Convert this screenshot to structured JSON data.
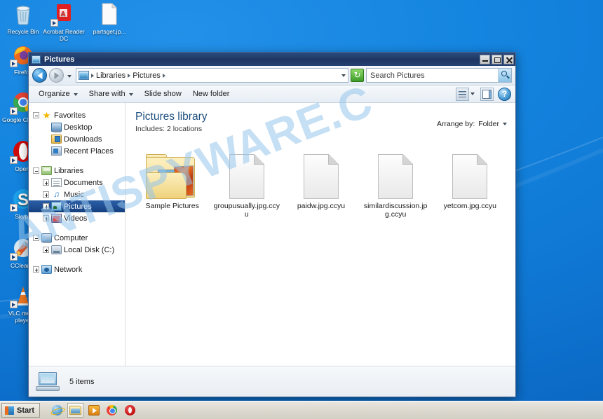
{
  "desktop": {
    "icons": [
      {
        "name": "recycle-bin",
        "label": "Recycle Bin",
        "shortcut": false
      },
      {
        "name": "acrobat-reader",
        "label": "Acrobat Reader DC",
        "shortcut": true
      },
      {
        "name": "partsget-jpg",
        "label": "partsget.jp...",
        "shortcut": false
      },
      {
        "name": "firefox",
        "label": "Firefox",
        "shortcut": true
      },
      {
        "name": "google-chrome",
        "label": "Google Chrome",
        "shortcut": true
      },
      {
        "name": "opera",
        "label": "Opera",
        "shortcut": true
      },
      {
        "name": "skype",
        "label": "Skype",
        "shortcut": true
      },
      {
        "name": "ccleaner",
        "label": "CCleaner",
        "shortcut": true
      },
      {
        "name": "vlc-media-player",
        "label": "VLC media player",
        "shortcut": true
      }
    ]
  },
  "window": {
    "title": "Pictures",
    "controls": {
      "minimize": "Minimize",
      "maximize": "Maximize",
      "close": "Close"
    }
  },
  "address": {
    "back": "Back",
    "forward": "Forward",
    "history": "Recent pages",
    "crumbs": [
      "Libraries",
      "Pictures"
    ],
    "refresh": "Refresh"
  },
  "search": {
    "placeholder": "Search Pictures",
    "value": "Search Pictures"
  },
  "toolbar": {
    "organize": "Organize",
    "share_with": "Share with",
    "slide_show": "Slide show",
    "new_folder": "New folder",
    "change_view": "Change your view",
    "preview_pane": "Show the preview pane",
    "help": "?"
  },
  "library": {
    "title": "Pictures library",
    "includes_label": "Includes:",
    "includes_value": "2 locations",
    "arrange_label": "Arrange by:",
    "arrange_value": "Folder"
  },
  "navpane": {
    "groups": [
      {
        "name": "favorites",
        "header": {
          "label": "Favorites",
          "icon": "star-icon",
          "expander": "minus"
        },
        "items": [
          {
            "label": "Desktop",
            "icon": "monitor-icon",
            "expander": "none",
            "selected": false
          },
          {
            "label": "Downloads",
            "icon": "downloads-folder-icon",
            "expander": "none",
            "selected": false
          },
          {
            "label": "Recent Places",
            "icon": "recent-places-icon",
            "expander": "none",
            "selected": false
          }
        ]
      },
      {
        "name": "libraries",
        "header": {
          "label": "Libraries",
          "icon": "library-icon",
          "expander": "minus"
        },
        "items": [
          {
            "label": "Documents",
            "icon": "document-icon",
            "expander": "plus",
            "selected": false
          },
          {
            "label": "Music",
            "icon": "music-note-icon",
            "expander": "plus",
            "selected": false
          },
          {
            "label": "Pictures",
            "icon": "pictures-icon",
            "expander": "plus",
            "selected": true
          },
          {
            "label": "Videos",
            "icon": "video-icon",
            "expander": "plus",
            "selected": false
          }
        ]
      },
      {
        "name": "computer",
        "header": {
          "label": "Computer",
          "icon": "computer-icon",
          "expander": "minus"
        },
        "items": [
          {
            "label": "Local Disk (C:)",
            "icon": "hard-disk-icon",
            "expander": "plus",
            "selected": false
          }
        ]
      },
      {
        "name": "network",
        "header": {
          "label": "Network",
          "icon": "network-icon",
          "expander": "plus"
        },
        "items": []
      }
    ]
  },
  "files": [
    {
      "name": "Sample Pictures",
      "icon": "pictures-folder-icon",
      "type": "folder"
    },
    {
      "name": "groupusually.jpg.ccyu",
      "icon": "blank-file-icon",
      "type": "file"
    },
    {
      "name": "paidw.jpg.ccyu",
      "icon": "blank-file-icon",
      "type": "file"
    },
    {
      "name": "similardiscussion.jpg.ccyu",
      "icon": "blank-file-icon",
      "type": "file"
    },
    {
      "name": "yetcom.jpg.ccyu",
      "icon": "blank-file-icon",
      "type": "file"
    }
  ],
  "statusbar": {
    "item_count": "5 items",
    "icon": "computer-icon"
  },
  "watermark": {
    "text": "ANTISPYWARE.C"
  },
  "taskbar": {
    "start": "Start",
    "tasks": [
      {
        "name": "internet-explorer",
        "label": "Internet Explorer",
        "active": false
      },
      {
        "name": "windows-explorer",
        "label": "Pictures",
        "active": true
      },
      {
        "name": "windows-media-player",
        "label": "Windows Media Player",
        "active": false
      },
      {
        "name": "google-chrome",
        "label": "Google Chrome",
        "active": false
      },
      {
        "name": "opera",
        "label": "Opera",
        "active": false
      }
    ]
  },
  "colors": {
    "titlebar": "#1f3a66",
    "selection": "#14407f",
    "desktop": "#1485e0",
    "library_title": "#1d4f7f",
    "watermark": "#96c4eb"
  }
}
